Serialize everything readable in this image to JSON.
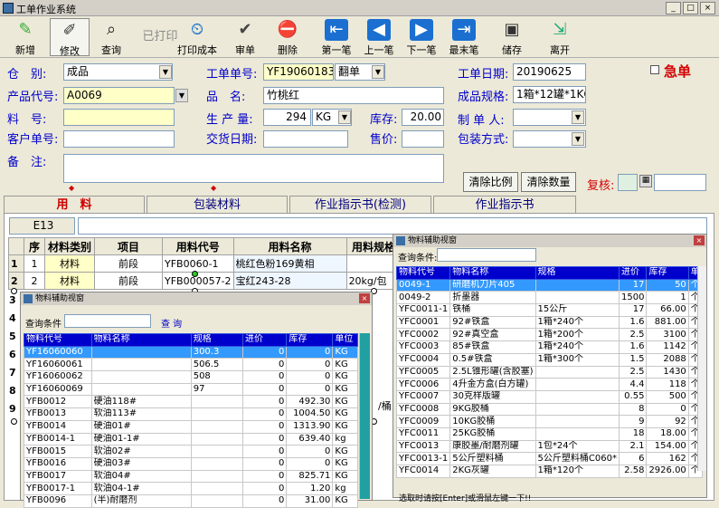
{
  "window": {
    "title": "工单作业系统",
    "min": "_",
    "max": "□",
    "close": "×"
  },
  "toolbar": [
    {
      "name": "new-button",
      "label": "新增",
      "icon": "✎"
    },
    {
      "name": "edit-button",
      "label": "修改",
      "icon": "✐"
    },
    {
      "name": "query-button",
      "label": "查询",
      "icon": "⌕"
    },
    {
      "name": "printed-button",
      "label": "已打印",
      "icon": ""
    },
    {
      "name": "print-cost-button",
      "label": "打印成本",
      "icon": "⏲"
    },
    {
      "name": "review-button",
      "label": "审单",
      "icon": "✔"
    },
    {
      "name": "delete-button",
      "label": "删除",
      "icon": "⛔"
    },
    {
      "name": "first-button",
      "label": "第一笔",
      "icon": "⇤"
    },
    {
      "name": "prev-button",
      "label": "上一笔",
      "icon": "◀"
    },
    {
      "name": "next-button",
      "label": "下一笔",
      "icon": "▶"
    },
    {
      "name": "last-button",
      "label": "最末笔",
      "icon": "⇥"
    },
    {
      "name": "save-button",
      "label": "储存",
      "icon": "▣"
    },
    {
      "name": "exit-button",
      "label": "离开",
      "icon": "⇲"
    }
  ],
  "form": {
    "warehouse_label": "仓　别:",
    "warehouse": "成品",
    "order_no_label": "工单单号:",
    "order_no": "YF19060183",
    "order_type": "翻单",
    "order_date_label": "工单日期:",
    "order_date": "20190625",
    "urgent_label": "急单",
    "product_code_label": "产品代号:",
    "product_code": "A0069",
    "product_name_label": "品　名:",
    "product_name": "竹桃红",
    "spec_label": "成品规格:",
    "spec": "1箱*12罐*1KG",
    "material_no_label": "料　号:",
    "material_no": "",
    "qty_label": "生 产 量:",
    "qty": "294",
    "unit": "KG",
    "stock_label": "库存:",
    "stock": "20.00",
    "maker_label": "制 单 人:",
    "maker": "",
    "customer_no_label": "客户单号:",
    "customer_no": "",
    "delivery_label": "交货日期:",
    "delivery": "",
    "price_label": "售价:",
    "price": "",
    "packing_label": "包装方式:",
    "packing": "",
    "remark_label": "备　注:",
    "remark": "",
    "clear_ratio": "清除比例",
    "clear_qty": "清除数量",
    "review_label": "复核:"
  },
  "tabs": [
    "用　料",
    "包装材料",
    "作业指示书(检测)",
    "作业指示书"
  ],
  "cell_ref": "E13",
  "grid": {
    "headers": [
      "序",
      "材料类别",
      "项目",
      "用料代号",
      "用料名称",
      "用料规格"
    ],
    "rows": [
      {
        "n": "1",
        "seq": "1",
        "cat": "材料",
        "item": "前段",
        "code": "YFB0060-1",
        "name": "桃红色粉169黄相",
        "spec": ""
      },
      {
        "n": "2",
        "seq": "2",
        "cat": "材料",
        "item": "前段",
        "code": "YFB000057-2",
        "name": "宝红243-28",
        "spec": "20kg/包"
      }
    ],
    "stub_rows": [
      "3",
      "4",
      "5",
      "6",
      "7",
      "8",
      "9"
    ],
    "partial_spec": "/桶"
  },
  "panel_left": {
    "title": "物料辅助视窗",
    "query_label": "查询条件",
    "query_btn": "查 询",
    "headers": [
      "物料代号",
      "物料名称",
      "规格",
      "进价",
      "库存",
      "单位"
    ],
    "rows": [
      [
        "YF16060060",
        "",
        "300.3",
        "0",
        "0",
        "KG"
      ],
      [
        "YF16060061",
        "",
        "506.5",
        "0",
        "0",
        "KG"
      ],
      [
        "YF16060062",
        "",
        "508",
        "0",
        "0",
        "KG"
      ],
      [
        "YF16060069",
        "",
        "97",
        "0",
        "0",
        "KG"
      ],
      [
        "YFB0012",
        "硬油118#",
        "",
        "0",
        "492.30",
        "KG"
      ],
      [
        "YFB0013",
        "软油113#",
        "",
        "0",
        "1004.50",
        "KG"
      ],
      [
        "YFB0014",
        "硬油01#",
        "",
        "0",
        "1313.90",
        "KG"
      ],
      [
        "YFB0014-1",
        "硬油01-1#",
        "",
        "0",
        "639.40",
        "kg"
      ],
      [
        "YFB0015",
        "软油02#",
        "",
        "0",
        "0",
        "KG"
      ],
      [
        "YFB0016",
        "硬油03#",
        "",
        "0",
        "0",
        "KG"
      ],
      [
        "YFB0017",
        "软油04#",
        "",
        "0",
        "825.71",
        "KG"
      ],
      [
        "YFB0017-1",
        "软油04-1#",
        "",
        "0",
        "1.20",
        "kg"
      ],
      [
        "YFB0096",
        "(半)耐磨剂",
        "",
        "0",
        "31.00",
        "KG"
      ]
    ]
  },
  "panel_right": {
    "title": "物料辅助视窗",
    "query_label": "查询条件:",
    "headers": [
      "物料代号",
      "物料名称",
      "规格",
      "进价",
      "库存",
      "单"
    ],
    "rows": [
      [
        "0049-1",
        "研磨机刀片405",
        "",
        "17",
        "50",
        "个"
      ],
      [
        "0049-2",
        "折墨器",
        "",
        "1500",
        "1",
        "个"
      ],
      [
        "YFC0011-1",
        "铁桶",
        "15公斤",
        "17",
        "66.00",
        "个"
      ],
      [
        "YFC0001",
        "92#铁盒",
        "1箱*240个",
        "1.6",
        "881.00",
        "个"
      ],
      [
        "YFC0002",
        "92#真空盒",
        "1箱*200个",
        "2.5",
        "3100",
        "个"
      ],
      [
        "YFC0003",
        "85#铁盒",
        "1箱*240个",
        "1.6",
        "1142",
        "个"
      ],
      [
        "YFC0004",
        "0.5#铁盒",
        "1箱*300个",
        "1.5",
        "2088",
        "个"
      ],
      [
        "YFC0005",
        "2.5L锥形罐(含胶塞)",
        "",
        "2.5",
        "1430",
        "个"
      ],
      [
        "YFC0006",
        "4升金方盒(白方罐)",
        "",
        "4.4",
        "118",
        "个"
      ],
      [
        "YFC0007",
        "30克样版罐",
        "",
        "0.55",
        "500",
        "个"
      ],
      [
        "YFC0008",
        "9KG胶桶",
        "",
        "8",
        "0",
        "个"
      ],
      [
        "YFC0009",
        "10KG胶桶",
        "",
        "9",
        "92",
        "个"
      ],
      [
        "YFC0011",
        "25KG胶桶",
        "",
        "18",
        "18.00",
        "个"
      ],
      [
        "YFC0013",
        "康胶墨/耐磨剂罐",
        "1包*24个",
        "2.1",
        "154.00",
        "个"
      ],
      [
        "YFC0013-1",
        "5公斤塑料桶",
        "5公斤塑料桶C060*",
        "6",
        "162",
        "个"
      ],
      [
        "YFC0014",
        "2KG灰罐",
        "1箱*120个",
        "2.58",
        "2926.00",
        "个"
      ]
    ],
    "footer": "选取时请按[Enter]或滑鼠左键一下!!"
  }
}
